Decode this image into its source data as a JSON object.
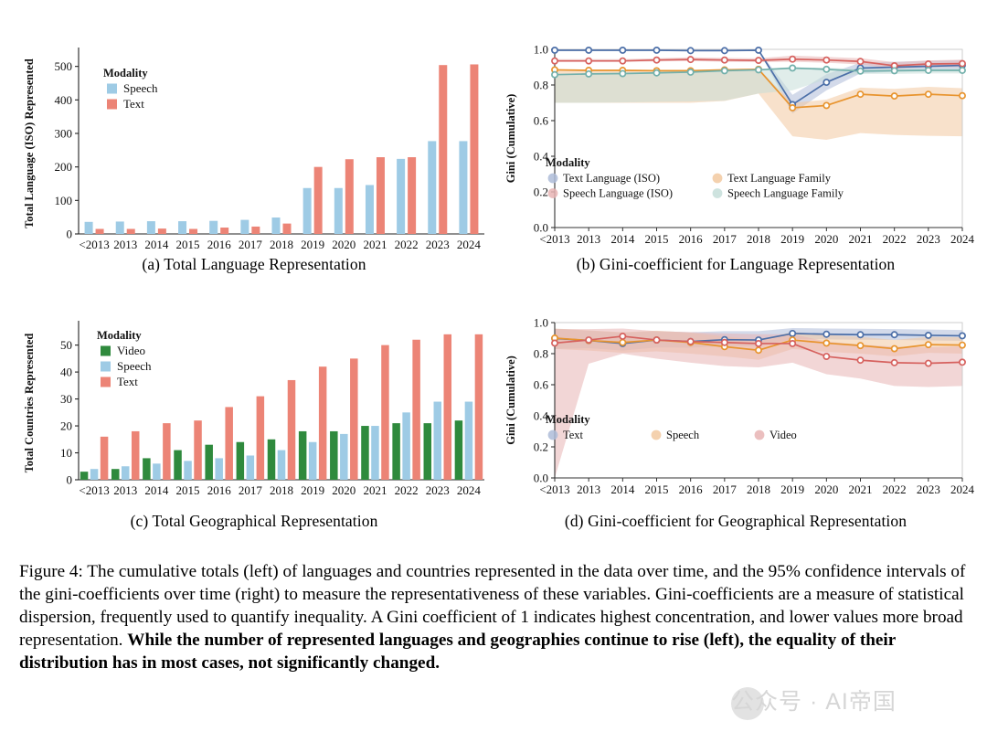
{
  "figure": {
    "caption_plain": "Figure 4: The cumulative totals (left) of languages and countries represented in the data over time, and the 95% confidence intervals of the gini-coefficients over time (right) to measure the representativeness of these variables. Gini-coefficients are a measure of statistical dispersion, frequently used to quantify inequality. A Gini coefficient of 1 indicates highest concentration, and lower values more broad representation. ",
    "caption_bold": "While the number of represented languages and geographies continue to rise (left), the equality of their distribution has in most cases, not significantly changed."
  },
  "watermark": {
    "text": "公众号 · AI帝国"
  },
  "colors": {
    "speech_bar": "#9ecbe5",
    "text_bar": "#ec8476",
    "video_bar": "#2f8a3d",
    "line_text_iso": "#4c6fa8",
    "line_speech_iso": "#d6615e",
    "line_text_family": "#e8942e",
    "line_speech_family": "#72b0ab",
    "line_video": "#d6615e",
    "band_text": "#aebcd8",
    "band_speech": "#f2c9a0",
    "band_video": "#e8b4b4"
  },
  "chart_data": [
    {
      "id": "panel-a",
      "type": "bar",
      "panel_label": "(a) Total Language Representation",
      "title": "",
      "xlabel": "",
      "ylabel": "Total Language (ISO) Represented",
      "ylim": [
        0,
        540
      ],
      "yticks": [
        0,
        100,
        200,
        300,
        400,
        500
      ],
      "ytick_labels": [
        "0",
        "100",
        "200",
        "300",
        "400",
        "500"
      ],
      "grid": false,
      "legend_title": "Modality",
      "legend_position": "upper-left-inside",
      "categories": [
        "<2013",
        "2013",
        "2014",
        "2015",
        "2016",
        "2017",
        "2018",
        "2019",
        "2020",
        "2021",
        "2022",
        "2023",
        "2024"
      ],
      "series": [
        {
          "name": "Speech",
          "color": "#9ecbe5",
          "values": [
            36,
            37,
            38,
            38,
            39,
            42,
            49,
            137,
            137,
            146,
            224,
            277,
            277
          ]
        },
        {
          "name": "Text",
          "color": "#ec8476",
          "values": [
            15,
            15,
            16,
            15,
            19,
            22,
            31,
            200,
            223,
            229,
            229,
            504,
            506
          ]
        }
      ]
    },
    {
      "id": "panel-b",
      "type": "line",
      "panel_label": "(b) Gini-coefficient for Language Representation",
      "title": "",
      "xlabel": "",
      "ylabel": "Gini (Cumulative)",
      "ylim": [
        0.0,
        1.0
      ],
      "yticks": [
        0.0,
        0.2,
        0.4,
        0.6,
        0.8,
        1.0
      ],
      "ytick_labels": [
        "0.0",
        "0.2",
        "0.4",
        "0.6",
        "0.8",
        "1.0"
      ],
      "grid": false,
      "legend_title": "Modality",
      "legend_position": "lower-left-inside",
      "x": [
        "<2013",
        "2013",
        "2014",
        "2015",
        "2016",
        "2017",
        "2018",
        "2019",
        "2020",
        "2021",
        "2022",
        "2023",
        "2024"
      ],
      "series": [
        {
          "name": "Text Language (ISO)",
          "color": "#4c6fa8",
          "band_color": "#aebcd8",
          "values": [
            0.995,
            0.995,
            0.995,
            0.995,
            0.993,
            0.993,
            0.995,
            0.69,
            0.815,
            0.895,
            0.9,
            0.905,
            0.91
          ],
          "band_low": [
            0.995,
            0.995,
            0.995,
            0.995,
            0.993,
            0.993,
            0.995,
            0.64,
            0.77,
            0.865,
            0.875,
            0.88,
            0.885
          ],
          "band_high": [
            0.995,
            0.995,
            0.995,
            0.995,
            0.993,
            0.993,
            0.995,
            0.745,
            0.86,
            0.925,
            0.93,
            0.935,
            0.94
          ]
        },
        {
          "name": "Speech Language (ISO)",
          "color": "#d6615e",
          "band_color": "#e8b4b4",
          "values": [
            0.935,
            0.935,
            0.935,
            0.94,
            0.943,
            0.94,
            0.938,
            0.945,
            0.94,
            0.932,
            0.908,
            0.918,
            0.92
          ],
          "band_low": [
            0.93,
            0.93,
            0.93,
            0.932,
            0.935,
            0.93,
            0.928,
            0.93,
            0.925,
            0.915,
            0.892,
            0.9,
            0.9
          ],
          "band_high": [
            0.945,
            0.945,
            0.945,
            0.95,
            0.955,
            0.952,
            0.95,
            0.965,
            0.958,
            0.95,
            0.928,
            0.938,
            0.942
          ]
        },
        {
          "name": "Text Language Family",
          "color": "#e8942e",
          "band_color": "#f2c9a0",
          "values": [
            0.885,
            0.882,
            0.882,
            0.88,
            0.88,
            0.885,
            0.888,
            0.672,
            0.685,
            0.748,
            0.738,
            0.748,
            0.74
          ],
          "band_low": [
            0.7,
            0.7,
            0.7,
            0.7,
            0.7,
            0.71,
            0.752,
            0.512,
            0.492,
            0.53,
            0.52,
            0.515,
            0.512
          ],
          "band_high": [
            0.888,
            0.886,
            0.886,
            0.884,
            0.884,
            0.89,
            0.892,
            0.7,
            0.718,
            0.785,
            0.778,
            0.79,
            0.782
          ]
        },
        {
          "name": "Speech Language Family",
          "color": "#72b0ab",
          "band_color": "#c6ded9",
          "values": [
            0.858,
            0.862,
            0.864,
            0.868,
            0.872,
            0.88,
            0.885,
            0.895,
            0.888,
            0.878,
            0.88,
            0.882,
            0.882
          ],
          "band_low": [
            0.7,
            0.7,
            0.702,
            0.705,
            0.708,
            0.712,
            0.752,
            0.77,
            0.832,
            0.862,
            0.862,
            0.865,
            0.865
          ],
          "band_high": [
            0.862,
            0.866,
            0.868,
            0.872,
            0.876,
            0.884,
            0.89,
            0.9,
            0.896,
            0.89,
            0.892,
            0.894,
            0.894
          ]
        }
      ]
    },
    {
      "id": "panel-c",
      "type": "bar",
      "panel_label": "(c) Total Geographical Representation",
      "title": "",
      "xlabel": "",
      "ylabel": "Total Countries Represented",
      "ylim": [
        0,
        57
      ],
      "yticks": [
        0,
        10,
        20,
        30,
        40,
        50
      ],
      "ytick_labels": [
        "0",
        "10",
        "20",
        "30",
        "40",
        "50"
      ],
      "grid": false,
      "legend_title": "Modality",
      "legend_position": "upper-left-inside",
      "categories": [
        "<2013",
        "2013",
        "2014",
        "2015",
        "2016",
        "2017",
        "2018",
        "2019",
        "2020",
        "2021",
        "2022",
        "2023",
        "2024"
      ],
      "series": [
        {
          "name": "Video",
          "color": "#2f8a3d",
          "values": [
            3,
            4,
            8,
            11,
            13,
            14,
            15,
            18,
            18,
            20,
            21,
            21,
            22
          ]
        },
        {
          "name": "Speech",
          "color": "#9ecbe5",
          "values": [
            4,
            5,
            6,
            7,
            8,
            9,
            11,
            14,
            17,
            20,
            25,
            29,
            29
          ]
        },
        {
          "name": "Text",
          "color": "#ec8476",
          "values": [
            16,
            18,
            21,
            22,
            27,
            31,
            37,
            42,
            45,
            50,
            52,
            54,
            54
          ]
        }
      ]
    },
    {
      "id": "panel-d",
      "type": "line",
      "panel_label": "(d) Gini-coefficient for Geographical Representation",
      "title": "",
      "xlabel": "",
      "ylabel": "Gini (Cumulative)",
      "ylim": [
        0.0,
        1.0
      ],
      "yticks": [
        0.0,
        0.2,
        0.4,
        0.6,
        0.8,
        1.0
      ],
      "ytick_labels": [
        "0.0",
        "0.2",
        "0.4",
        "0.6",
        "0.8",
        "1.0"
      ],
      "grid": false,
      "legend_title": "Modality",
      "legend_position": "lower-left-inside",
      "x": [
        "<2013",
        "2013",
        "2014",
        "2015",
        "2016",
        "2017",
        "2018",
        "2019",
        "2020",
        "2021",
        "2022",
        "2023",
        "2024"
      ],
      "series": [
        {
          "name": "Text",
          "color": "#4c6fa8",
          "band_color": "#aebcd8",
          "values": [
            0.898,
            0.885,
            0.865,
            0.888,
            0.878,
            0.89,
            0.888,
            0.93,
            0.925,
            0.922,
            0.922,
            0.918,
            0.915
          ],
          "band_low": [
            0.83,
            0.835,
            0.82,
            0.84,
            0.838,
            0.85,
            0.848,
            0.895,
            0.892,
            0.89,
            0.888,
            0.885,
            0.882
          ],
          "band_high": [
            0.96,
            0.948,
            0.935,
            0.945,
            0.938,
            0.945,
            0.945,
            0.965,
            0.962,
            0.96,
            0.958,
            0.955,
            0.952
          ]
        },
        {
          "name": "Speech",
          "color": "#e8942e",
          "band_color": "#f2c9a0",
          "values": [
            0.9,
            0.885,
            0.872,
            0.888,
            0.872,
            0.845,
            0.822,
            0.888,
            0.868,
            0.852,
            0.832,
            0.858,
            0.855
          ],
          "band_low": [
            0.83,
            0.82,
            0.805,
            0.815,
            0.8,
            0.782,
            0.76,
            0.83,
            0.812,
            0.8,
            0.782,
            0.805,
            0.8
          ],
          "band_high": [
            0.962,
            0.95,
            0.938,
            0.948,
            0.935,
            0.912,
            0.888,
            0.94,
            0.922,
            0.908,
            0.888,
            0.908,
            0.905
          ]
        },
        {
          "name": "Video",
          "color": "#d6615e",
          "band_color": "#e8b4b4",
          "values": [
            0.868,
            0.888,
            0.912,
            0.888,
            0.878,
            0.872,
            0.865,
            0.865,
            0.782,
            0.758,
            0.742,
            0.738,
            0.745
          ],
          "band_low": [
            0.0,
            0.735,
            0.8,
            0.768,
            0.742,
            0.72,
            0.712,
            0.742,
            0.668,
            0.64,
            0.592,
            0.585,
            0.592
          ],
          "band_high": [
            0.958,
            0.958,
            0.962,
            0.945,
            0.938,
            0.93,
            0.925,
            0.925,
            0.878,
            0.858,
            0.845,
            0.842,
            0.848
          ]
        }
      ]
    }
  ]
}
